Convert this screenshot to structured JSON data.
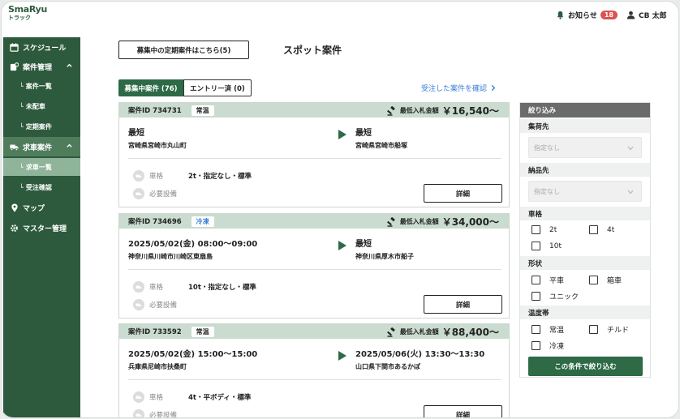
{
  "app": {
    "brand": "SmaRyu",
    "brand_sub": "トラック"
  },
  "header": {
    "notification_label": "お知らせ",
    "notification_count": "18",
    "user_name": "CB 太郎"
  },
  "sidebar": {
    "items": [
      {
        "label": "スケジュール",
        "icon": "calendar-icon"
      },
      {
        "label": "案件管理",
        "icon": "case-gear-icon"
      },
      {
        "label": "案件一覧",
        "prefix": "└"
      },
      {
        "label": "未配車",
        "prefix": "└"
      },
      {
        "label": "定期案件",
        "prefix": "└"
      },
      {
        "label": "求車案件",
        "icon": "truck-icon"
      },
      {
        "label": "求車一覧",
        "prefix": "└"
      },
      {
        "label": "受注確認",
        "prefix": "└"
      },
      {
        "label": "マップ",
        "icon": "map-pin-icon"
      },
      {
        "label": "マスター管理",
        "icon": "gear-icon"
      }
    ]
  },
  "main": {
    "regular_button": "募集中の定期案件はこちら(5)",
    "title": "スポット案件",
    "tabs": [
      {
        "label": "募集中案件 (76)"
      },
      {
        "label": "エントリー済 (0)"
      }
    ],
    "confirm_link": "受注した案件を確認"
  },
  "cards": [
    {
      "id": "案件ID 734731",
      "temp": "常温",
      "price_label": "最低入札金額",
      "price": "￥16,540〜",
      "from_date": "最短",
      "from_addr": "宮崎県宮崎市丸山町",
      "to_date": "最短",
      "to_addr": "宮崎県宮崎市船塚",
      "vehicle_label": "車格",
      "vehicle_value": "2t・指定なし・標準",
      "equip_label": "必要設備",
      "equip_value": "",
      "detail": "詳細"
    },
    {
      "id": "案件ID 734696",
      "temp": "冷凍",
      "price_label": "最低入札金額",
      "price": "￥34,000〜",
      "from_date": "2025/05/02(金) 08:00〜09:00",
      "from_addr": "神奈川県川崎市川崎区東扇島",
      "to_date": "最短",
      "to_addr": "神奈川県厚木市船子",
      "vehicle_label": "車格",
      "vehicle_value": "10t・指定なし・標準",
      "equip_label": "必要設備",
      "equip_value": "",
      "detail": "詳細"
    },
    {
      "id": "案件ID 733592",
      "temp": "常温",
      "price_label": "最低入札金額",
      "price": "￥88,400〜",
      "from_date": "2025/05/02(金) 15:00〜15:00",
      "from_addr": "兵庫県尼崎市扶桑町",
      "to_date": "2025/05/06(火) 13:30〜13:30",
      "to_addr": "山口県下関市あるかぽ",
      "vehicle_label": "車格",
      "vehicle_value": "4t・平ボディ・標準",
      "equip_label": "必要設備",
      "equip_value": "",
      "detail": "詳細"
    }
  ],
  "filter": {
    "title": "絞り込み",
    "pickup_label": "集荷先",
    "pickup_value": "指定なし",
    "delivery_label": "納品先",
    "delivery_value": "指定なし",
    "vehicle_label": "車格",
    "vehicle_options": [
      "2t",
      "4t",
      "10t"
    ],
    "shape_label": "形状",
    "shape_options": [
      "平車",
      "箱車",
      "ユニック"
    ],
    "temp_label": "温度帯",
    "temp_options": [
      "常温",
      "チルド",
      "冷凍"
    ],
    "apply": "この条件で絞り込む"
  },
  "colors": {
    "primary": "#2d6a45",
    "sidebar": "#2d5a3d",
    "card_header": "#c9dccf",
    "link": "#3b7ed6",
    "badge": "#d9534f"
  }
}
